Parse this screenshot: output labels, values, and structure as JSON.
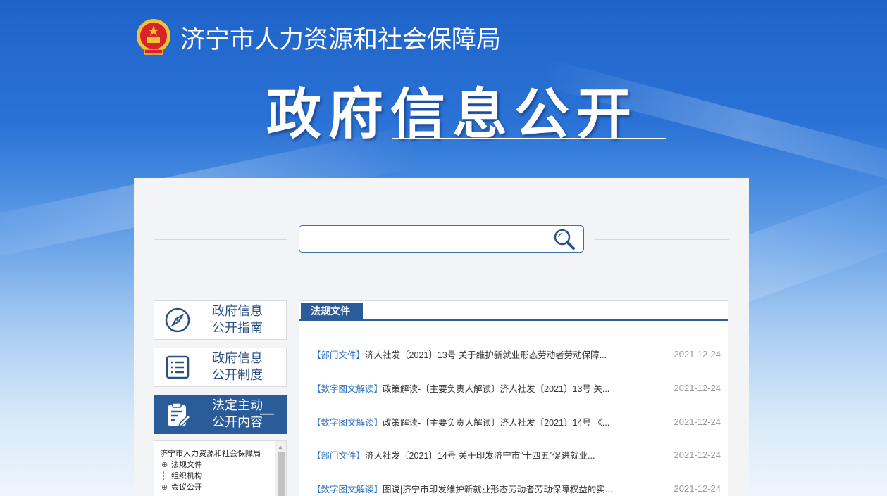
{
  "header": {
    "site_name": "济宁市人力资源和社会保障局",
    "main_title": "政府信息公开"
  },
  "search": {
    "value": "",
    "placeholder": ""
  },
  "sidebar": {
    "items": [
      {
        "line1": "政府信息",
        "line2": "公开指南",
        "icon": "compass-icon",
        "active": false
      },
      {
        "line1": "政府信息",
        "line2": "公开制度",
        "icon": "list-document-icon",
        "active": false
      },
      {
        "line1": "法定主动",
        "line2": "公开内容",
        "icon": "clipboard-edit-icon",
        "active": true,
        "toggle": "—"
      }
    ],
    "tree": {
      "root": "济宁市人力资源和社会保障局",
      "nodes": [
        {
          "symbol": "⊕",
          "label": "法规文件"
        },
        {
          "symbol": "┆",
          "label": "组织机构"
        },
        {
          "symbol": "⊕",
          "label": "会议公开"
        }
      ]
    }
  },
  "content": {
    "tab": "法规文件",
    "items": [
      {
        "category": "【部门文件】",
        "title": "济人社发〔2021〕13号 关于维护新就业形态劳动者劳动保障...",
        "date": "2021-12-24"
      },
      {
        "category": "【数字图文解读】",
        "title": "政策解读-〔主要负责人解读〕济人社发〔2021〕13号 关...",
        "date": "2021-12-24"
      },
      {
        "category": "【数字图文解读】",
        "title": "政策解读-〔主要负责人解读〕济人社发〔2021〕14号 《...",
        "date": "2021-12-24"
      },
      {
        "category": "【部门文件】",
        "title": "济人社发〔2021〕14号 关于印发济宁市“十四五”促进就业...",
        "date": "2021-12-24"
      },
      {
        "category": "【数字图文解读】",
        "title": "图说|济宁市印发维护新就业形态劳动者劳动保障权益的实...",
        "date": "2021-12-24"
      }
    ]
  },
  "colors": {
    "primary": "#2a5c9a",
    "link": "#2a6fc4",
    "date": "#999999"
  }
}
